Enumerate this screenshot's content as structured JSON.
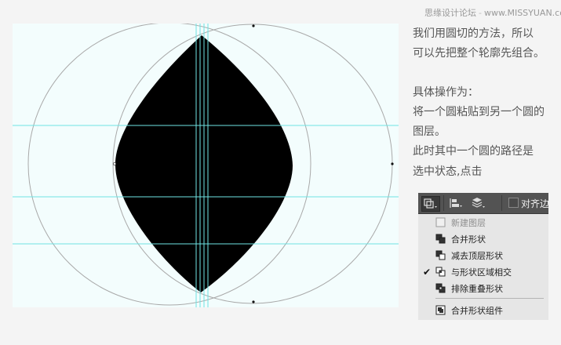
{
  "watermark": {
    "site_cn": "思缘设计论坛",
    "site_url": "www.MISSYUAN.com"
  },
  "description": {
    "paragraph1": [
      "我们用圆切的方法，所以",
      "可以先把整个轮廓先组合。"
    ],
    "paragraph2": [
      "具体操作为：",
      "将一个圆粘贴到另一个圆的",
      "图层。",
      "此时其中一个圆的路径是",
      "选中状态,点击"
    ]
  },
  "ps_panel": {
    "toolbar": {
      "align_edges_label": "对齐边"
    },
    "menu": {
      "items": [
        {
          "label": "新建图层",
          "enabled": false,
          "checked": false,
          "icon": "new-layer-icon"
        },
        {
          "label": "合并形状",
          "enabled": true,
          "checked": false,
          "icon": "combine-shapes-icon"
        },
        {
          "label": "减去顶层形状",
          "enabled": true,
          "checked": false,
          "icon": "subtract-front-shape-icon"
        },
        {
          "label": "与形状区域相交",
          "enabled": true,
          "checked": true,
          "icon": "intersect-shape-areas-icon"
        },
        {
          "label": "排除重叠形状",
          "enabled": true,
          "checked": false,
          "icon": "exclude-overlapping-shapes-icon"
        },
        {
          "label": "合并形状组件",
          "enabled": true,
          "checked": false,
          "icon": "merge-shape-components-icon"
        }
      ],
      "check_mark": "✔"
    }
  },
  "colors": {
    "canvas_bg": "#f3fdfd",
    "guide": "#66e0e0",
    "shape": "#000000",
    "circle_outline": "#a9a9a9"
  }
}
